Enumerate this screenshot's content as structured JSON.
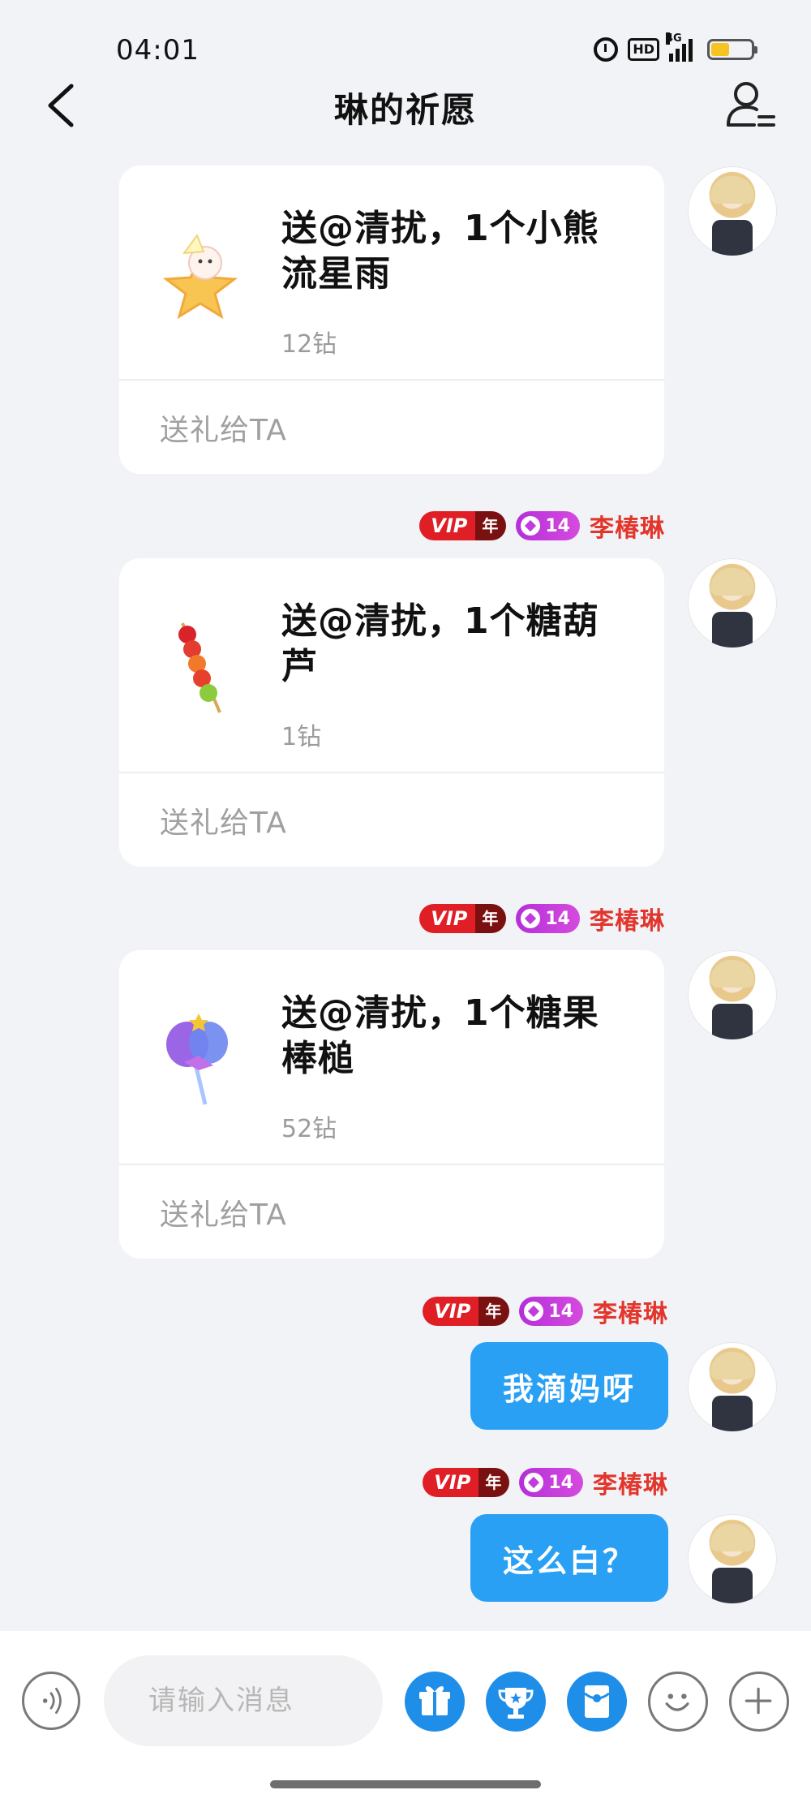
{
  "status_bar": {
    "time": "04:01",
    "hd_label": "HD",
    "network": "4G",
    "battery_color": "#f6c323"
  },
  "header": {
    "title": "琳的祈愿"
  },
  "messages": [
    {
      "type": "gift",
      "text": "送@清扰，1个小熊流星雨",
      "price": "12钻",
      "action": "送礼给TA",
      "icon": "bear-star-gift-icon",
      "show_badges": false
    },
    {
      "type": "gift",
      "text": "送@清扰，1个糖葫芦",
      "price": "1钻",
      "action": "送礼给TA",
      "icon": "candied-haws-gift-icon",
      "show_badges": true
    },
    {
      "type": "gift",
      "text": "送@清扰，1个糖果棒槌",
      "price": "52钻",
      "action": "送礼给TA",
      "icon": "candy-wand-gift-icon",
      "show_badges": true
    },
    {
      "type": "text",
      "text": "我滴妈呀",
      "show_badges": true
    },
    {
      "type": "text",
      "text": "这么白？",
      "show_badges": true
    }
  ],
  "user": {
    "name": "李椿琳",
    "vip_label": "VIP",
    "vip_period": "年",
    "level": "14"
  },
  "input_bar": {
    "placeholder": "请输入消息",
    "buttons": [
      "voice-icon",
      "gift-icon",
      "trophy-icon",
      "red-packet-icon",
      "emoji-icon",
      "plus-icon"
    ]
  },
  "colors": {
    "accent_blue": "#2aa0f5",
    "name_red": "#e2362c",
    "vip_red": "#e01e26",
    "level_purple": "#c23bdc"
  }
}
